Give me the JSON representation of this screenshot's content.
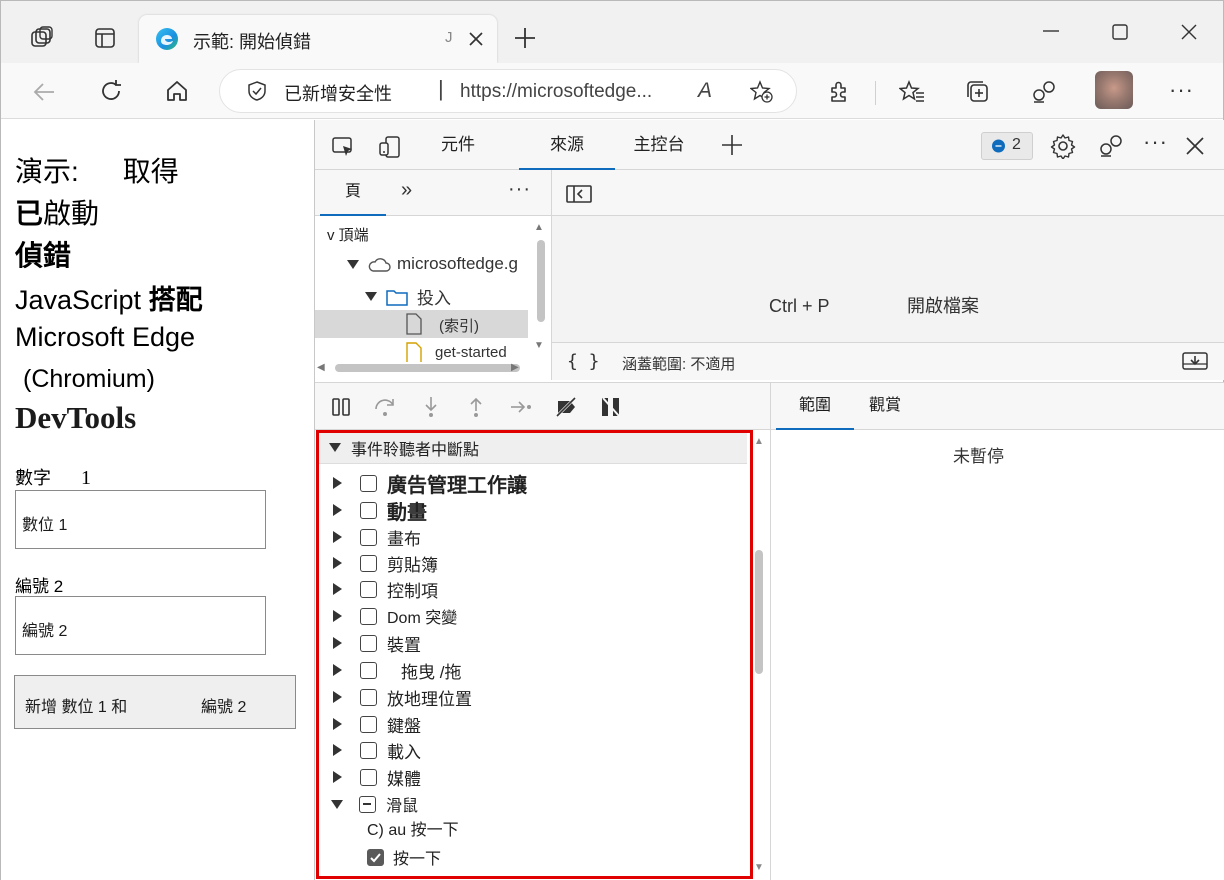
{
  "browser": {
    "tab_title": "示範: 開始偵錯",
    "tab_extra": "J",
    "security_label": "已新增安全性",
    "url": "https://microsoftedge...",
    "read_aloud": "A"
  },
  "page": {
    "heading_line1a": "演示:",
    "heading_line1b": "取得",
    "heading_line2a": "已",
    "heading_line2b": "啟動",
    "heading_line3": "偵錯",
    "heading_line4a": "JavaScript",
    "heading_line4b": "搭配",
    "heading_line5": "Microsoft Edge",
    "heading_line6": "(Chromium)",
    "heading_line7": "DevTools",
    "number1_label": "數字",
    "number1_index": "1",
    "number1_placeholder": "數位 1",
    "number2_label": "編號 2",
    "number2_placeholder": "編號 2",
    "add_button_a": "新增 數位 1 和",
    "add_button_b": "編號 2"
  },
  "devtools": {
    "tabs": [
      "元件",
      "來源",
      "主控台"
    ],
    "issues_count": "2",
    "nav": {
      "tab_page": "頁",
      "tree": {
        "top": "v 頂端",
        "origin": "microsoftedge.g",
        "folder": "投入",
        "file1": "(索引)",
        "file2": "get-started"
      }
    },
    "editor": {
      "shortcut": "Ctrl + P",
      "open_file": "開啟檔案",
      "braces": "{ }",
      "coverage": "涵蓋範圍: 不適用"
    },
    "scope_tabs": [
      "範圍",
      "觀賞"
    ],
    "not_paused": "未暫停",
    "breakpoints": {
      "header": "事件聆聽者中斷點",
      "items": [
        "廣告管理工作讓",
        "動畫",
        "畫布",
        "剪貼簿",
        "控制項",
        "Dom 突變",
        "裝置",
        "拖曳 /拖",
        "放地理位置",
        "鍵盤",
        "載入",
        "媒體",
        "滑鼠"
      ],
      "sub_items": [
        "C) au 按一下",
        "按一下"
      ]
    }
  },
  "colors": {
    "accent": "#0f6cbd",
    "highlight_box": "#e00000"
  }
}
